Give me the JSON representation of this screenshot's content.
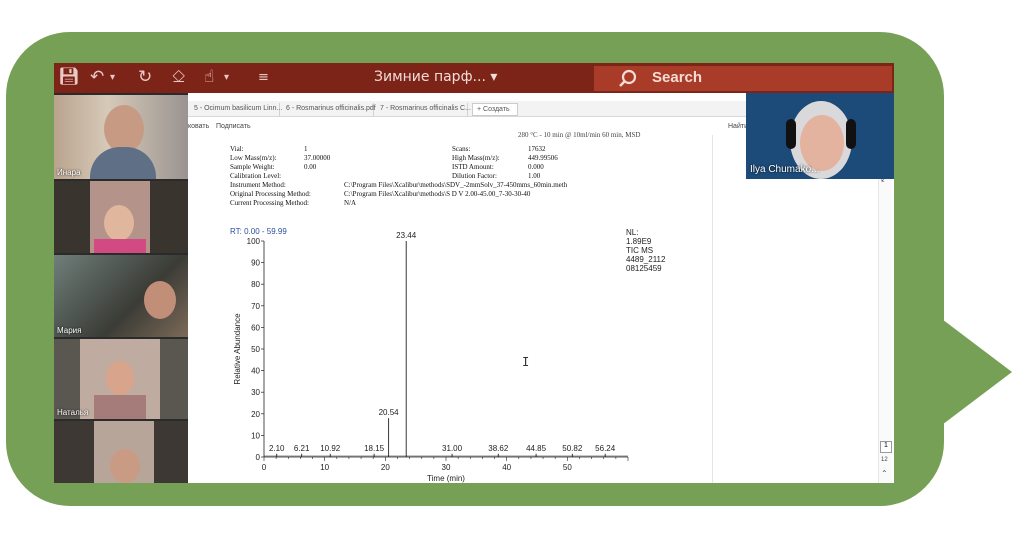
{
  "ppt": {
    "doc_title": "Зимние парф...  ▾",
    "search_label": "Search",
    "qat_icons": [
      "save-icon",
      "undo-icon",
      "redo-icon",
      "present-icon",
      "touch-icon",
      "customize-icon"
    ]
  },
  "participants": [
    {
      "name": "Инара"
    },
    {
      "name": ""
    },
    {
      "name": "Мария"
    },
    {
      "name": "Наталья"
    },
    {
      "name": ""
    }
  ],
  "speaker": {
    "name": "Ilya Chumako..."
  },
  "pdf": {
    "tabs": [
      "5 - Ocimum basilicum Linn...",
      "6 - Rosmarinus officinalis.pdf",
      "7 - Rosmarinus officinalis C...",
      "+ Создать"
    ],
    "toolbar_left": [
      "ковать",
      "Подписать"
    ],
    "toolbar_right": "Найти текст или инстру",
    "side_page_numbers": [
      "1",
      "12"
    ],
    "meta_left": [
      {
        "label": "Vial:",
        "value": "1"
      },
      {
        "label": "Low Mass(m/z):",
        "value": "37.00000"
      },
      {
        "label": "Sample Weight:",
        "value": "0.00"
      },
      {
        "label": "Calibration Level:",
        "value": ""
      },
      {
        "label": "Instrument Method:",
        "value": "C:\\Program Files\\Xcalibur\\methods\\SDV_-2mmSolv_37-450mms_60min.meth"
      },
      {
        "label": "Original Processing Method:",
        "value": "C:\\Program Files\\Xcalibur\\methods\\S D V 2.00-45.00_7-30-30-40"
      },
      {
        "label": "Current Processing Method:",
        "value": "N/A"
      }
    ],
    "meta_right": [
      {
        "label": "Scans:",
        "value": "17632"
      },
      {
        "label": "High Mass(m/z):",
        "value": "449.99506"
      },
      {
        "label": "ISTD Amount:",
        "value": "0.000"
      },
      {
        "label": "Dilution Factor:",
        "value": "1.00"
      }
    ],
    "meta_top_cut": "280 °C - 10 min @ 10ml/min  60 min, MSD"
  },
  "chart_data": {
    "type": "line",
    "title": "RT: 0.00 - 59.99",
    "xlabel": "Time (min)",
    "ylabel": "Relative Abundance",
    "xlim": [
      0,
      60
    ],
    "ylim": [
      0,
      100
    ],
    "x_ticks": [
      0,
      10,
      20,
      30,
      40,
      50
    ],
    "y_ticks": [
      0,
      10,
      20,
      30,
      40,
      50,
      60,
      70,
      80,
      90,
      100
    ],
    "peaks": [
      {
        "x": 2.1,
        "y": 1.5,
        "label": "2.10"
      },
      {
        "x": 6.21,
        "y": 1.5,
        "label": "6.21"
      },
      {
        "x": 10.92,
        "y": 1.5,
        "label": "10.92"
      },
      {
        "x": 18.15,
        "y": 1.5,
        "label": "18.15"
      },
      {
        "x": 20.54,
        "y": 18,
        "label": "20.54"
      },
      {
        "x": 23.44,
        "y": 100,
        "label": "23.44"
      },
      {
        "x": 31.0,
        "y": 1.5,
        "label": "31.00"
      },
      {
        "x": 38.62,
        "y": 1.5,
        "label": "38.62"
      },
      {
        "x": 44.85,
        "y": 1.5,
        "label": "44.85"
      },
      {
        "x": 50.82,
        "y": 1.5,
        "label": "50.82"
      },
      {
        "x": 56.24,
        "y": 1.5,
        "label": "56.24"
      }
    ],
    "annotation": [
      "NL:",
      "1.89E9",
      "TIC  MS",
      "4489_2112",
      "08125459"
    ]
  }
}
